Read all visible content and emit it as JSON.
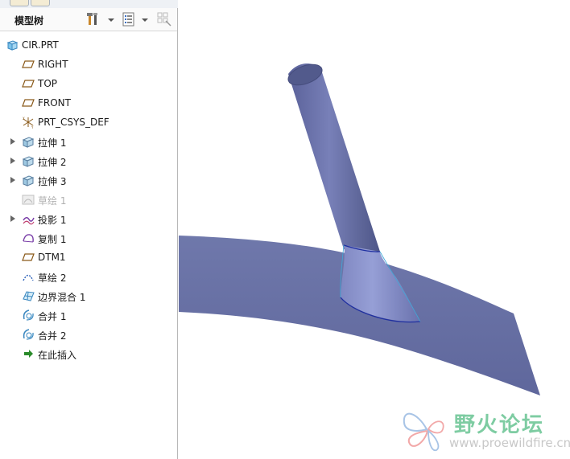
{
  "panel": {
    "title": "模型树"
  },
  "tree": {
    "items": [
      {
        "label": "CIR.PRT",
        "icon": "part-icon"
      },
      {
        "label": "RIGHT",
        "icon": "datum-plane-icon"
      },
      {
        "label": "TOP",
        "icon": "datum-plane-icon"
      },
      {
        "label": "FRONT",
        "icon": "datum-plane-icon"
      },
      {
        "label": "PRT_CSYS_DEF",
        "icon": "csys-icon"
      },
      {
        "label": "拉伸 1",
        "icon": "extrude-icon"
      },
      {
        "label": "拉伸 2",
        "icon": "extrude-icon"
      },
      {
        "label": "拉伸 3",
        "icon": "extrude-icon"
      },
      {
        "label": "草绘 1",
        "icon": "sketch-icon"
      },
      {
        "label": "投影 1",
        "icon": "projection-icon"
      },
      {
        "label": "复制 1",
        "icon": "copy-icon"
      },
      {
        "label": "DTM1",
        "icon": "datum-plane-icon"
      },
      {
        "label": "草绘 2",
        "icon": "sketch-icon"
      },
      {
        "label": "边界混合 1",
        "icon": "boundary-blend-icon"
      },
      {
        "label": "合并 1",
        "icon": "merge-icon"
      },
      {
        "label": "合并 2",
        "icon": "merge-icon"
      },
      {
        "label": "在此插入",
        "icon": "insert-here-arrow-icon"
      }
    ]
  },
  "watermark": {
    "title": "野火论坛",
    "url": "www.proewildfire.cn"
  },
  "colors": {
    "surface": "#6b73a8",
    "edge": "#1f2fa0",
    "accent": "#2a8a2a"
  }
}
